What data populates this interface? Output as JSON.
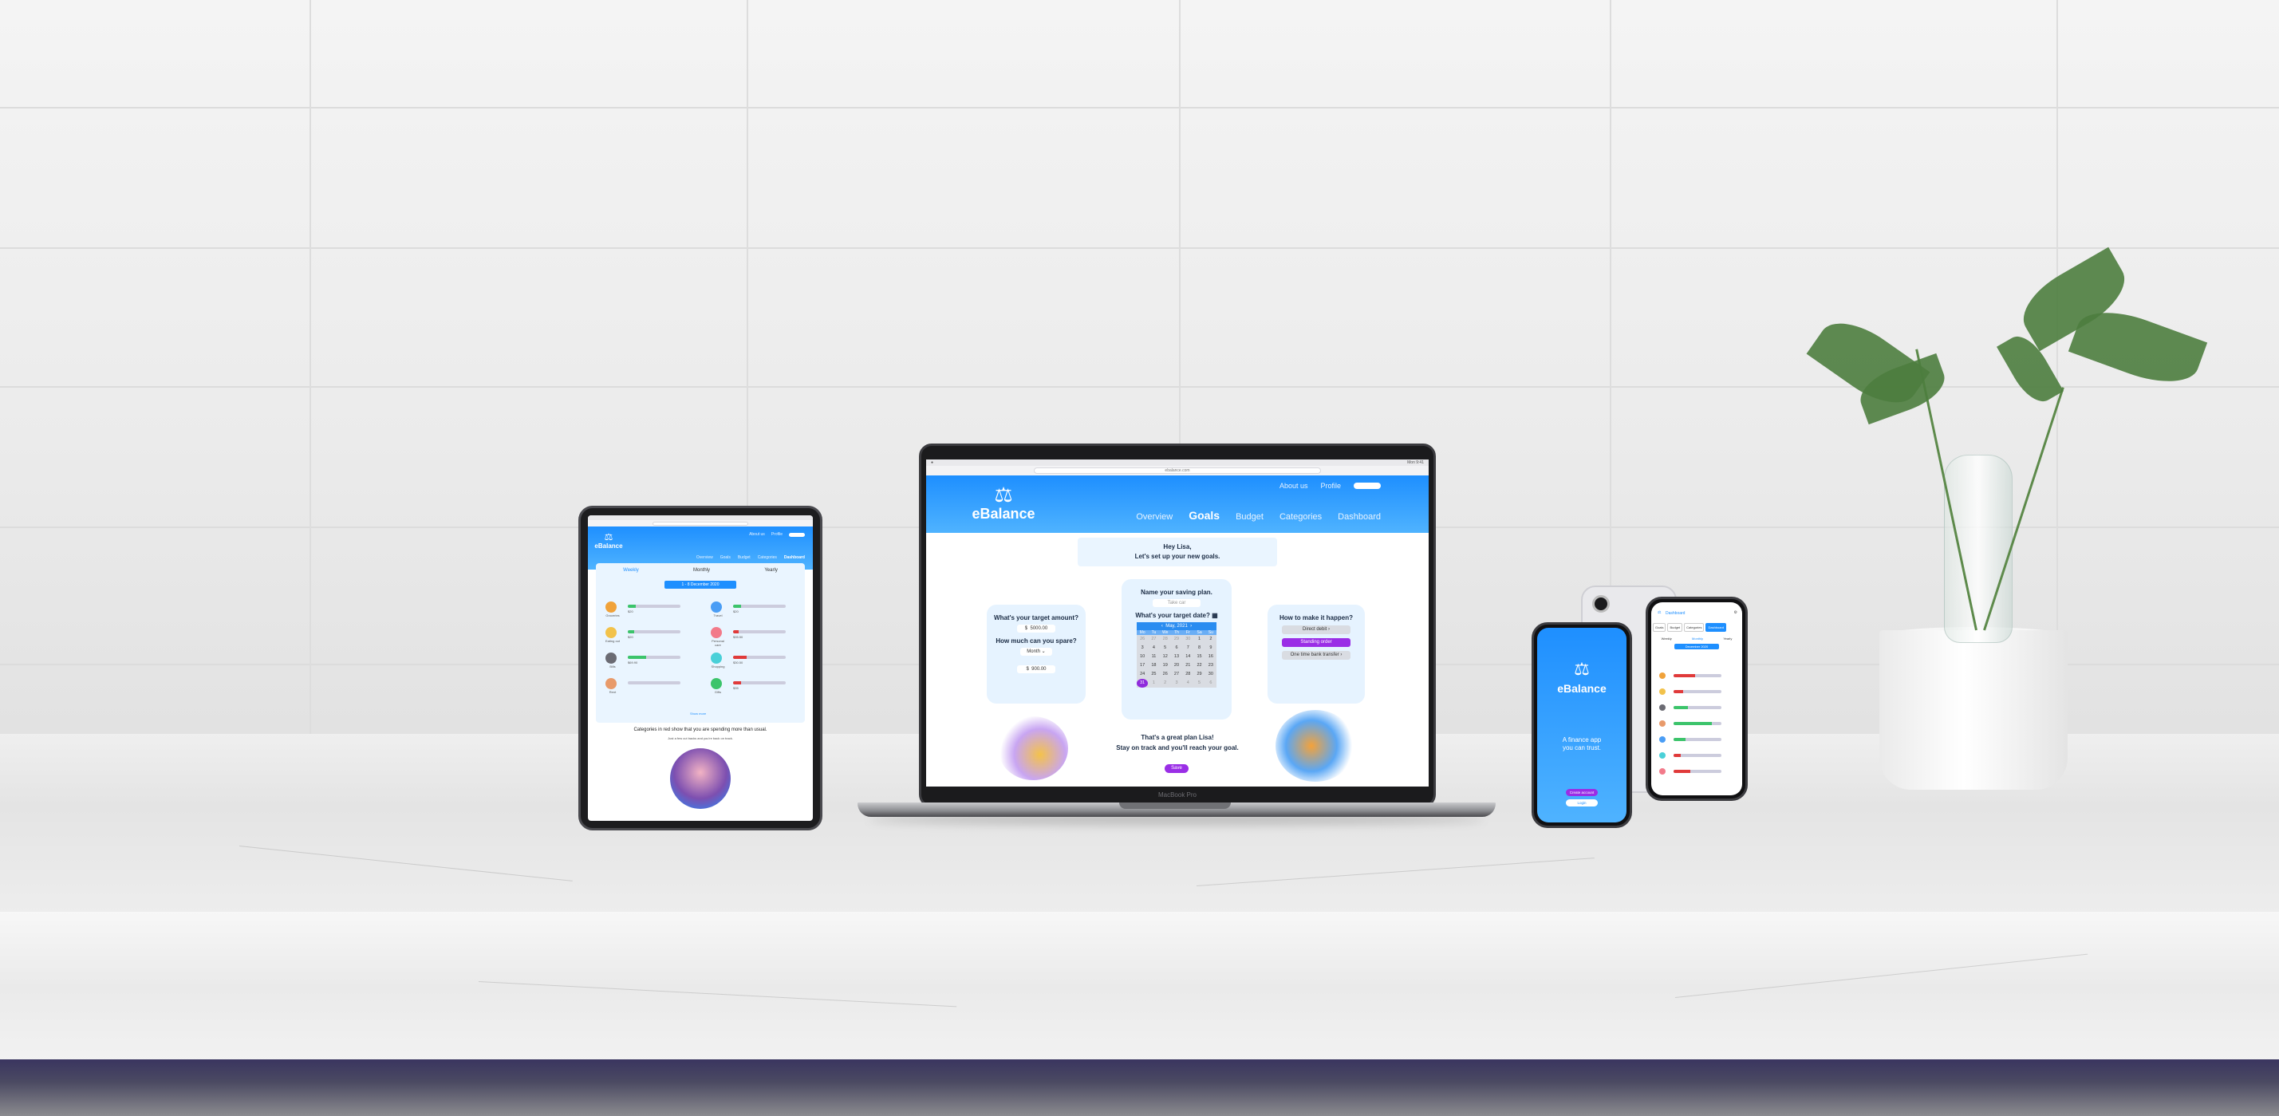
{
  "laptop": {
    "url": "ebalance.com",
    "menubar_right": "Mon 9:41",
    "top_links": [
      "About us",
      "Profile"
    ],
    "brand": "eBalance",
    "nav": [
      "Overview",
      "Goals",
      "Budget",
      "Categories",
      "Dashboard"
    ],
    "active_nav": "Goals",
    "greeting_line1": "Hey Lisa,",
    "greeting_line2": "Let's set up your new goals.",
    "target_amount_q": "What's your target amount?",
    "target_amount_currency": "$",
    "target_amount_value": "5000.00",
    "spare_q": "How much can you spare?",
    "spare_period": "Month",
    "spare_currency": "$",
    "spare_value": "900.00",
    "plan_name_q": "Name your saving plan.",
    "plan_name_value": "Take car",
    "target_date_q": "What's your target date?",
    "calendar_month": "May, 2021",
    "calendar_weekdays": [
      "Mo",
      "Tu",
      "We",
      "Th",
      "Fr",
      "Sa",
      "Su"
    ],
    "calendar_days": [
      "26",
      "27",
      "28",
      "29",
      "30",
      "1",
      "2",
      "3",
      "4",
      "5",
      "6",
      "7",
      "8",
      "9",
      "10",
      "11",
      "12",
      "13",
      "14",
      "15",
      "16",
      "17",
      "18",
      "19",
      "20",
      "21",
      "22",
      "23",
      "24",
      "25",
      "26",
      "27",
      "28",
      "29",
      "30",
      "31",
      "1",
      "2",
      "3",
      "4",
      "5",
      "6"
    ],
    "calendar_selected": "31",
    "how_q": "How to make it happen?",
    "how_options": [
      "Direct debit",
      "Standing order",
      "One time bank transfer"
    ],
    "how_selected": "Standing order",
    "plan_line1": "That's a great plan Lisa!",
    "plan_line2": "Stay on track and you'll reach your goal.",
    "save_label": "Save",
    "chin_label": "MacBook Pro"
  },
  "tablet": {
    "brand": "eBalance",
    "top_links": [
      "About us",
      "Profile"
    ],
    "nav": [
      "Overview",
      "Goals",
      "Budget",
      "Categories",
      "Dashboard"
    ],
    "active_nav": "Dashboard",
    "tabs": [
      "Weekly",
      "Monthly",
      "Yearly"
    ],
    "active_tab": "Weekly",
    "date_range": "1 - 8 December 2020",
    "categories": [
      {
        "label": "Groceries",
        "value": "$20",
        "fill": 0.15,
        "color": "#f0a23a",
        "bar": "#3cc46b"
      },
      {
        "label": "Travel",
        "value": "$20",
        "fill": 0.15,
        "color": "#4a9df5",
        "bar": "#3cc46b"
      },
      {
        "label": "Eating out",
        "value": "$20",
        "fill": 0.12,
        "color": "#f2c24a",
        "bar": "#3cc46b"
      },
      {
        "label": "Personal care",
        "value": "$35.50",
        "fill": 0.1,
        "color": "#f27a8a",
        "bar": "#e03a3a"
      },
      {
        "label": "Bills",
        "value": "$69.90",
        "fill": 0.35,
        "color": "#6b6b73",
        "bar": "#3cc46b"
      },
      {
        "label": "Shopping",
        "value": "$30.50",
        "fill": 0.25,
        "color": "#4ad0d8",
        "bar": "#e03a3a"
      },
      {
        "label": "Rent",
        "value": "",
        "fill": 0,
        "color": "#e89a6a",
        "bar": "#3cc46b"
      },
      {
        "label": "Gifts",
        "value": "$35",
        "fill": 0.15,
        "color": "#3cc46b",
        "bar": "#e03a3a"
      }
    ],
    "show_more": "Show more",
    "note": "Categories in red show that you are spending more than usual.",
    "sub_note": "Just a few cut backs and you're back on track."
  },
  "phone1": {
    "brand": "eBalance",
    "tagline1": "A finance app",
    "tagline2": "you can trust.",
    "create_label": "Create account",
    "login_label": "Login"
  },
  "phone2": {
    "title": "Dashboard",
    "tabs": [
      "Goals",
      "Budget",
      "Categories",
      "Dashboard"
    ],
    "active_tab": "Dashboard",
    "period_tabs": [
      "Weekly",
      "Monthly",
      "Yearly"
    ],
    "active_period": "Monthly",
    "date_range": "December 2020",
    "rows": [
      {
        "color": "#f0a23a",
        "bar": "#e03a3a",
        "fill": 0.45
      },
      {
        "color": "#f2c24a",
        "bar": "#e03a3a",
        "fill": 0.2
      },
      {
        "color": "#6b6b73",
        "bar": "#3cc46b",
        "fill": 0.3
      },
      {
        "color": "#e89a6a",
        "bar": "#3cc46b",
        "fill": 0.8
      },
      {
        "color": "#4a9df5",
        "bar": "#3cc46b",
        "fill": 0.25
      },
      {
        "color": "#4ad0d8",
        "bar": "#e03a3a",
        "fill": 0.15
      },
      {
        "color": "#f27a8a",
        "bar": "#e03a3a",
        "fill": 0.35
      }
    ]
  },
  "colors": {
    "brand_blue": "#1e8fff",
    "accent_purple": "#9a2ee6",
    "card_bg": "#e6f3ff"
  }
}
